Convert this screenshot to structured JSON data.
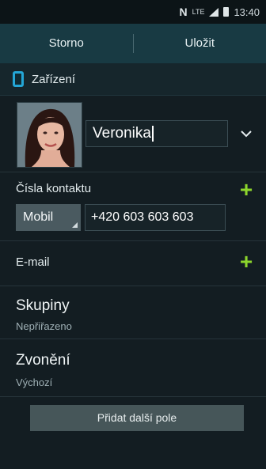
{
  "status_bar": {
    "network_label": "LTE",
    "time": "13:40"
  },
  "action_bar": {
    "cancel_label": "Storno",
    "save_label": "Uložit"
  },
  "storage": {
    "label": "Zařízení",
    "icon": "device-icon"
  },
  "contact": {
    "name_value": "Veronika"
  },
  "phone": {
    "section_label": "Čísla kontaktu",
    "type_value": "Mobil",
    "number_value": "+420 603 603 603"
  },
  "email": {
    "section_label": "E-mail"
  },
  "groups": {
    "label": "Skupiny",
    "value": "Nepřiřazeno"
  },
  "ringtone": {
    "label": "Zvonění",
    "value": "Výchozí"
  },
  "add_field": {
    "label": "Přidat další pole"
  },
  "colors": {
    "accent_plus": "#8dd62c",
    "action_bar": "#183a43",
    "device_icon": "#24a6d6"
  }
}
